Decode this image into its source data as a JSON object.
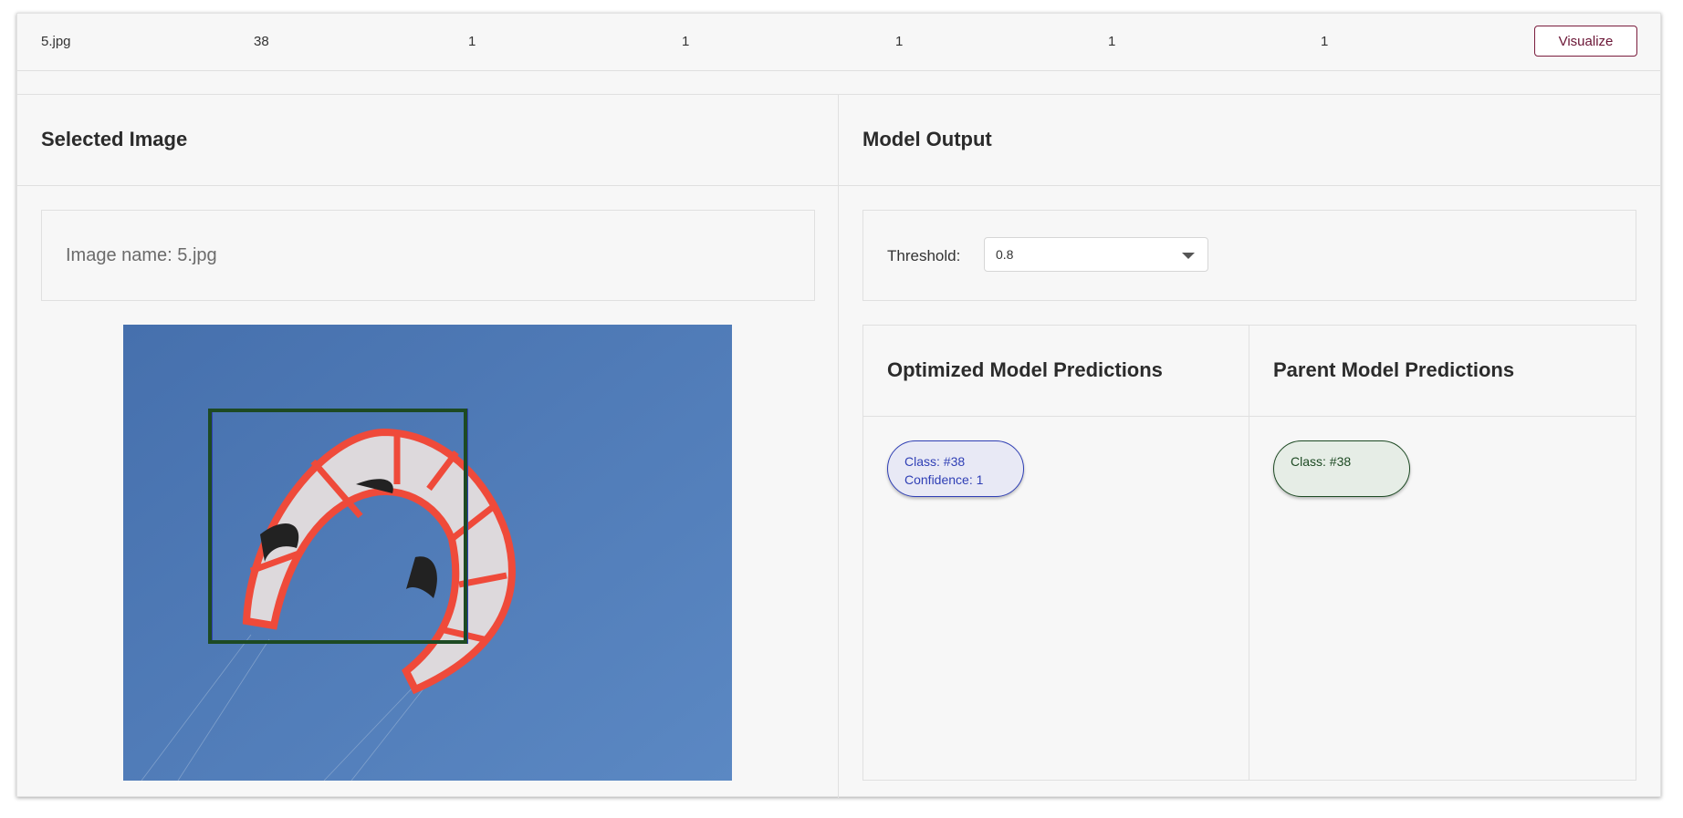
{
  "row": {
    "file": "5.jpg",
    "class": "38",
    "v1": "1",
    "v2": "1",
    "v3": "1",
    "v4": "1",
    "v5": "1",
    "visualize_label": "Visualize"
  },
  "left_panel": {
    "title": "Selected Image",
    "image_name_label": "Image name: 5.jpg"
  },
  "right_panel": {
    "title": "Model Output",
    "threshold_label": "Threshold:",
    "threshold_value": "0.8",
    "optimized_title": "Optimized Model Predictions",
    "parent_title": "Parent Model Predictions",
    "optimized_chip": {
      "class": "Class: #38",
      "confidence": "Confidence: 1"
    },
    "parent_chip": {
      "class": "Class: #38"
    }
  },
  "colors": {
    "accent": "#6a1535",
    "optimized_box": "#2f3fb5",
    "parent_box": "#1d4a23",
    "sky": "#4f7fbd"
  },
  "icons": {
    "dropdown": "chevron-down-icon"
  }
}
